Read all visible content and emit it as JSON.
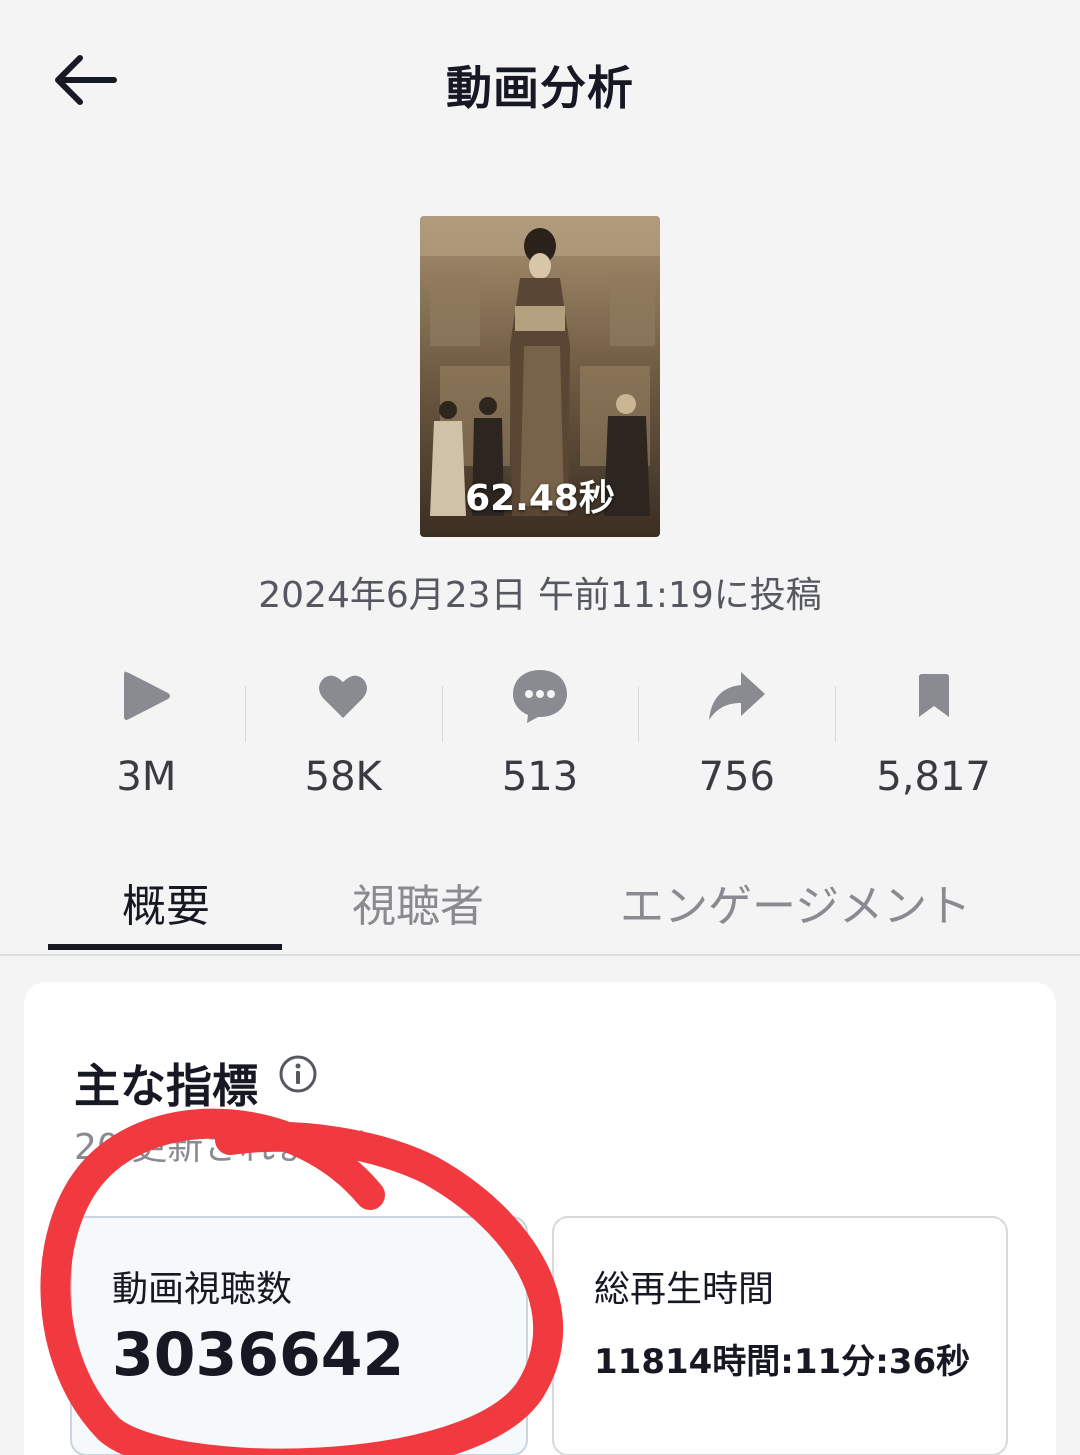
{
  "header": {
    "title": "動画分析"
  },
  "video": {
    "duration": "62.48秒",
    "posted": "2024年6月23日 午前11:19に投稿"
  },
  "stats": [
    {
      "icon": "play-icon",
      "value": "3M"
    },
    {
      "icon": "heart-icon",
      "value": "58K"
    },
    {
      "icon": "comment-icon",
      "value": "513"
    },
    {
      "icon": "share-icon",
      "value": "756"
    },
    {
      "icon": "bookmark-icon",
      "value": "5,817"
    }
  ],
  "tabs": [
    {
      "label": "概要",
      "active": true
    },
    {
      "label": "視聴者",
      "active": false
    },
    {
      "label": "エンゲージメント",
      "active": false
    }
  ],
  "key_metrics": {
    "title": "主な指標",
    "updated_visible_text": "20           更新されました。",
    "cards": [
      {
        "label": "動画視聴数",
        "value": "3036642"
      },
      {
        "label": "総再生時間",
        "value": "11814時間:11分:36秒"
      }
    ]
  },
  "colors": {
    "background": "#f4f4f4",
    "text_primary": "#161823",
    "text_secondary": "#8a8b91",
    "icon_gray": "#8a8b91",
    "annotation_red": "#f03a3f"
  }
}
